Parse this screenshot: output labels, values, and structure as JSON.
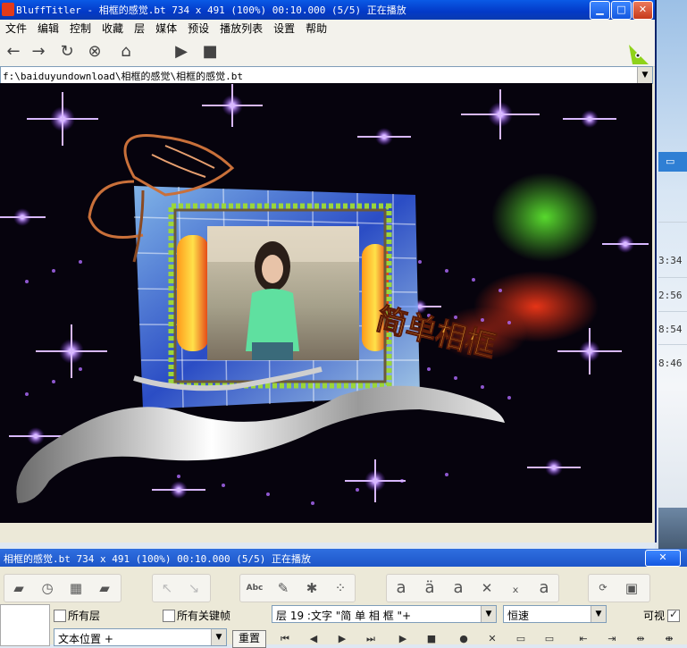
{
  "window": {
    "title": "BluffTitler - 相框的感觉.bt 734 x 491 (100%) 00:10.000 (5/5) 正在播放"
  },
  "menu": [
    "文件",
    "编辑",
    "控制",
    "收藏",
    "层",
    "媒体",
    "预设",
    "播放列表",
    "设置",
    "帮助"
  ],
  "toolbar": [
    "arrow-left-icon",
    "arrow-right-icon",
    "refresh-icon",
    "stop-circle-icon",
    "home-icon",
    "play-icon",
    "stop-icon"
  ],
  "path": {
    "value": "f:\\baiduyundownload\\相框的感觉\\相框的感觉.bt"
  },
  "preview": {
    "caption": "简单相框"
  },
  "background_window": {
    "times": [
      "3:34",
      "2:56",
      "8:54",
      "8:46"
    ]
  },
  "panel": {
    "title": "相框的感觉.bt 734 x 491 (100%) 00:10.000 (5/5) 正在播放",
    "close": "✕",
    "all_layers": "所有层",
    "all_keyframes": "所有关键帧",
    "layer_select": "层   19  :文字 \"简 单 相 框      \"+",
    "speed_select": "恒速",
    "visible_label": "可视",
    "visible_checked": true,
    "property_select": "文本位置 +",
    "reset": "重置",
    "icon_abc": "Abc"
  },
  "colors": {
    "titlebar": "#0339c7",
    "preview_bg": "#06030d",
    "accent_purple": "#8a3cff"
  }
}
